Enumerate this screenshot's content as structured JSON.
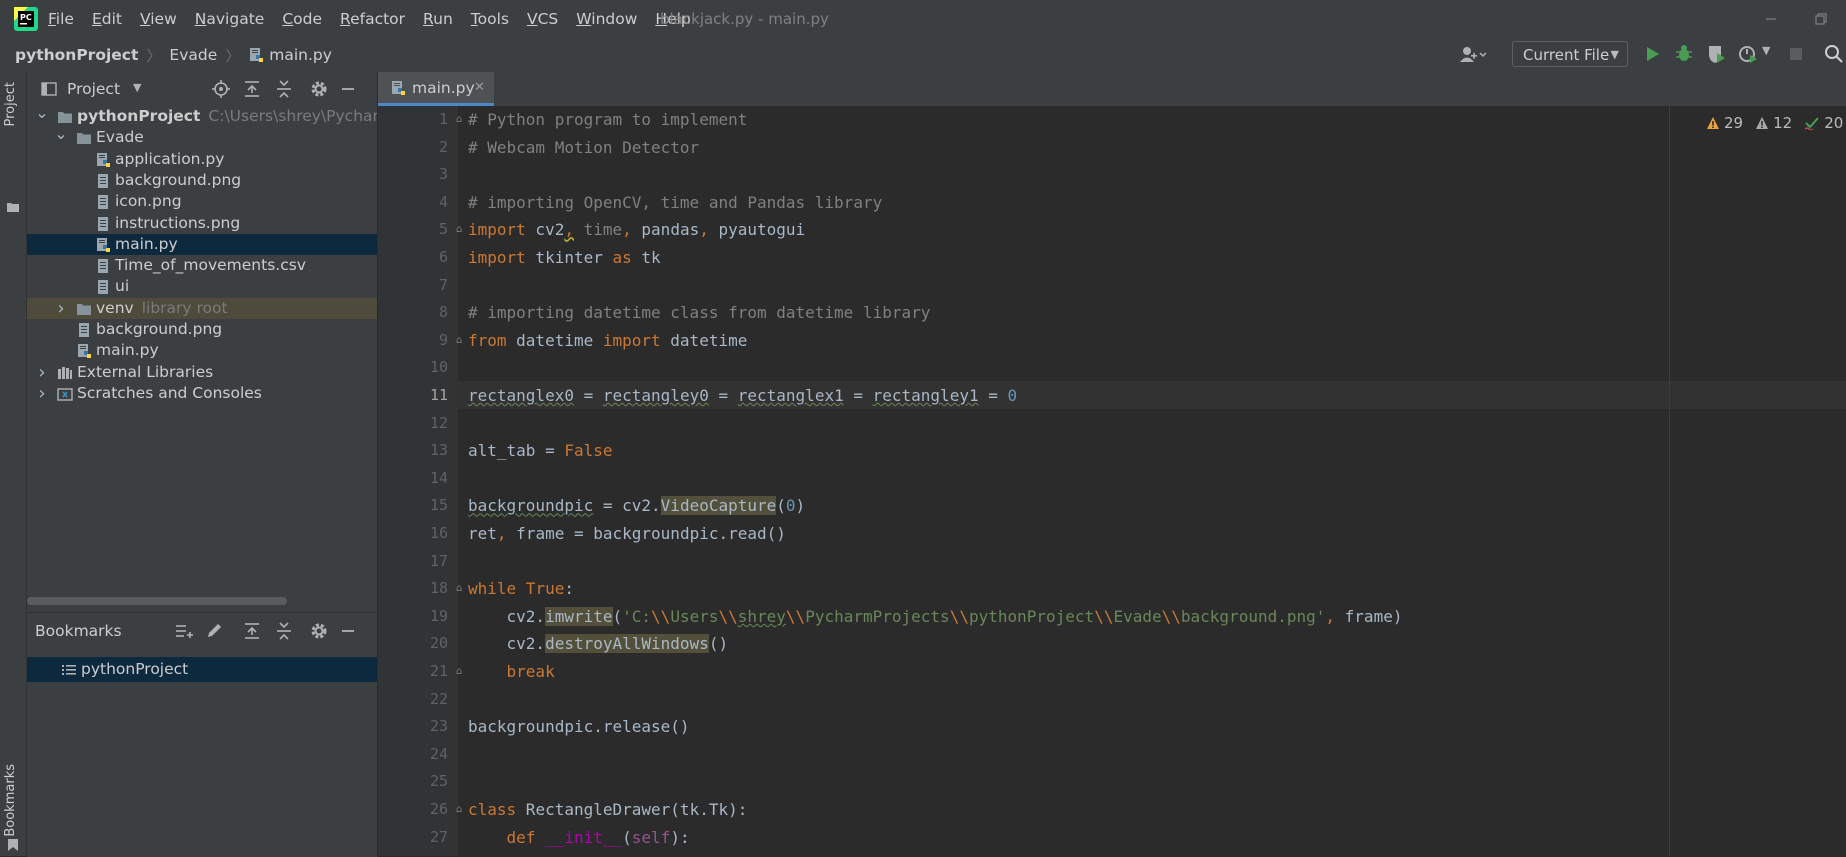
{
  "window": {
    "title": "blackjack.py - main.py",
    "menu": [
      {
        "label": "File",
        "mnemonic": "F",
        "rest": "ile"
      },
      {
        "label": "Edit",
        "mnemonic": "E",
        "rest": "dit"
      },
      {
        "label": "View",
        "mnemonic": "V",
        "rest": "iew"
      },
      {
        "label": "Navigate",
        "mnemonic": "N",
        "rest": "avigate"
      },
      {
        "label": "Code",
        "mnemonic": "C",
        "rest": "ode"
      },
      {
        "label": "Refactor",
        "mnemonic": "R",
        "rest": "efactor"
      },
      {
        "label": "Run",
        "mnemonic": "R",
        "rest": "un"
      },
      {
        "label": "Tools",
        "mnemonic": "T",
        "rest": "ools"
      },
      {
        "label": "VCS",
        "mnemonic": "V",
        "rest": "CS"
      },
      {
        "label": "Window",
        "mnemonic": "W",
        "rest": "indow"
      },
      {
        "label": "Help",
        "mnemonic": "H",
        "rest": "elp"
      }
    ]
  },
  "navbar": {
    "breadcrumb": [
      "pythonProject",
      "Evade",
      "main.py"
    ],
    "run_config": "Current File"
  },
  "sidebar": {
    "stripe_top": "Project",
    "stripe_bottom": "Bookmarks"
  },
  "project": {
    "title": "Project",
    "tree": [
      {
        "label": "pythonProject",
        "hint": "C:\\Users\\shrey\\PycharmProjects\\pythonProject",
        "icon": "folder-icon",
        "arrow": "down"
      },
      {
        "label": "Evade",
        "hint": "",
        "icon": "folder-icon",
        "arrow": "down"
      },
      {
        "label": "application.py",
        "hint": "",
        "icon": "python-file-icon",
        "arrow": ""
      },
      {
        "label": "background.png",
        "hint": "",
        "icon": "image-file-icon",
        "arrow": ""
      },
      {
        "label": "icon.png",
        "hint": "",
        "icon": "image-file-icon",
        "arrow": ""
      },
      {
        "label": "instructions.png",
        "hint": "",
        "icon": "image-file-icon",
        "arrow": ""
      },
      {
        "label": "main.py",
        "hint": "",
        "icon": "python-file-icon",
        "arrow": ""
      },
      {
        "label": "Time_of_movements.csv",
        "hint": "",
        "icon": "text-file-icon",
        "arrow": ""
      },
      {
        "label": "ui",
        "hint": "",
        "icon": "text-file-icon",
        "arrow": ""
      },
      {
        "label": "venv",
        "hint": "library root",
        "icon": "folder-icon",
        "arrow": "right"
      },
      {
        "label": "background.png",
        "hint": "",
        "icon": "image-file-icon",
        "arrow": ""
      },
      {
        "label": "main.py",
        "hint": "",
        "icon": "python-file-icon",
        "arrow": ""
      },
      {
        "label": "External Libraries",
        "hint": "",
        "icon": "library-icon",
        "arrow": "right"
      },
      {
        "label": "Scratches and Consoles",
        "hint": "",
        "icon": "scratches-icon",
        "arrow": "right"
      }
    ]
  },
  "bookmarks": {
    "title": "Bookmarks",
    "items": [
      "pythonProject"
    ]
  },
  "editor": {
    "tab": "main.py",
    "inspections": {
      "warnings": "29",
      "weak_warnings": "12",
      "typos": "20"
    },
    "current_line": 11,
    "line_numbers": [
      "1",
      "2",
      "3",
      "4",
      "5",
      "6",
      "7",
      "8",
      "9",
      "10",
      "11",
      "12",
      "13",
      "14",
      "15",
      "16",
      "17",
      "18",
      "19",
      "20",
      "21",
      "22",
      "23",
      "24",
      "25",
      "26",
      "27"
    ],
    "code": {
      "l1": "# Python program to implement",
      "l2": "# Webcam Motion Detector",
      "l4": "# importing OpenCV, time and Pandas library",
      "l5a": "import",
      "l5b": " cv2",
      "l5c": ",",
      "l5d": " time",
      "l5e": ",",
      "l5f": " pandas",
      "l5g": ",",
      "l5h": " pyautogui",
      "l6a": "import",
      "l6b": " tkinter ",
      "l6c": "as",
      "l6d": " tk",
      "l8": "# importing datetime class from datetime library",
      "l9a": "from",
      "l9b": " datetime ",
      "l9c": "import",
      "l9d": " datetime",
      "l11a": "rectanglex0",
      "l11b": " = ",
      "l11c": "rectangley0",
      "l11d": " = ",
      "l11e": "rectanglex1",
      "l11f": " = ",
      "l11g": "rectangley1",
      "l11h": " = ",
      "l11i": "0",
      "l13a": "alt_tab = ",
      "l13b": "False",
      "l15a": "backgroundpic",
      "l15b": " = cv2.",
      "l15c": "VideoCapture",
      "l15d": "(",
      "l15e": "0",
      "l15f": ")",
      "l16a": "ret",
      "l16b": ",",
      "l16c": " frame = backgroundpic.read()",
      "l18a": "while",
      "l18b": " True",
      "l18c": ":",
      "l19a": "    cv2.",
      "l19b": "imwrite",
      "l19c": "(",
      "l19d": "'C:",
      "l19e": "\\\\",
      "l19f": "Users",
      "l19g": "\\\\",
      "l19h": "shrey",
      "l19i": "\\\\",
      "l19j": "PycharmProjects",
      "l19k": "\\\\",
      "l19l": "pythonProject",
      "l19m": "\\\\",
      "l19n": "Evade",
      "l19o": "\\\\",
      "l19p": "background.png'",
      "l19q": ",",
      "l19r": " frame)",
      "l20a": "    cv2.",
      "l20b": "destroyAllWindows",
      "l20c": "()",
      "l21": "    break",
      "l23": "backgroundpic.release()",
      "l26a": "class",
      "l26b": " RectangleDrawer(tk.Tk):",
      "l27a": "    def",
      "l27b": " ",
      "l27c": "__init__",
      "l27d": "(",
      "l27e": "self",
      "l27f": "):"
    }
  },
  "colors": {
    "editor_bg": "#2b2b2b",
    "panel_bg": "#3c3f41",
    "keyword": "#cc7832",
    "comment": "#808080",
    "string": "#6a8759",
    "number": "#6897bb",
    "selection": "#0d293e",
    "run_green": "#499c54",
    "warning_yellow": "#e8a33e"
  }
}
